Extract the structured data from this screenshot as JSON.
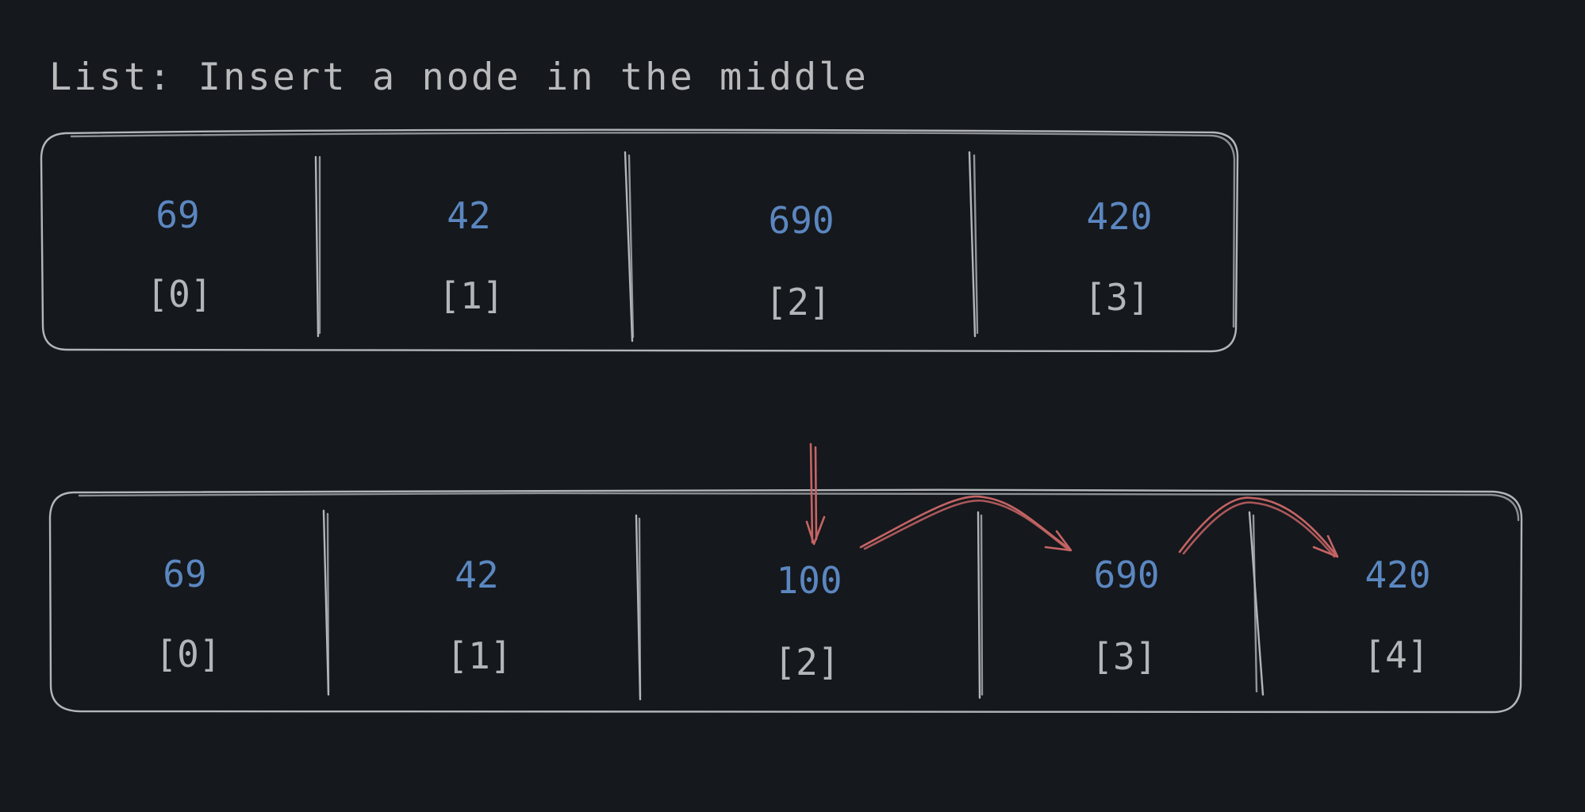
{
  "title": "List: Insert a node in the middle",
  "colors": {
    "background": "#15181d",
    "value": "#5b87c0",
    "index": "#b3b6b9",
    "arrow": "#c46464"
  },
  "lists": [
    {
      "cells": [
        {
          "value": "69",
          "index": "[0]"
        },
        {
          "value": "42",
          "index": "[1]"
        },
        {
          "value": "690",
          "index": "[2]"
        },
        {
          "value": "420",
          "index": "[3]"
        }
      ]
    },
    {
      "cells": [
        {
          "value": "69",
          "index": "[0]"
        },
        {
          "value": "42",
          "index": "[1]"
        },
        {
          "value": "100",
          "index": "[2]"
        },
        {
          "value": "690",
          "index": "[3]"
        },
        {
          "value": "420",
          "index": "[4]"
        }
      ]
    }
  ]
}
